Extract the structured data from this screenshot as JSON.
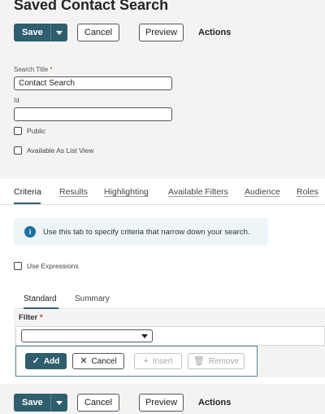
{
  "page": {
    "title": "Saved Contact Search"
  },
  "toolbar": {
    "save_label": "Save",
    "cancel_label": "Cancel",
    "preview_label": "Preview",
    "actions_label": "Actions"
  },
  "form": {
    "search_title": {
      "label": "Search Title",
      "required_mark": "*",
      "value": "Contact Search"
    },
    "id": {
      "label": "Id",
      "value": ""
    },
    "public": {
      "label": "Public",
      "checked": false
    },
    "list_view": {
      "label": "Available As List View",
      "checked": false
    }
  },
  "tabs": [
    {
      "label": "Criteria",
      "active": true
    },
    {
      "label": "Results",
      "active": false
    },
    {
      "label": "Highlighting",
      "active": false
    },
    {
      "label": "Available Filters",
      "active": false
    },
    {
      "label": "Audience",
      "active": false
    },
    {
      "label": "Roles",
      "active": false
    }
  ],
  "info": {
    "icon": "info-icon",
    "text": "Use this tab to specify criteria that narrow down your search."
  },
  "use_expressions": {
    "label": "Use Expressions",
    "checked": false
  },
  "subtabs": [
    {
      "label": "Standard",
      "active": true
    },
    {
      "label": "Summary",
      "active": false
    }
  ],
  "filter": {
    "label": "Filter",
    "required_mark": "*",
    "selected": "",
    "buttons": {
      "add": "Add",
      "cancel": "Cancel",
      "insert": "Insert",
      "remove": "Remove"
    }
  },
  "colors": {
    "primary": "#2f5e6e",
    "info_icon": "#1b6f9e",
    "required": "#c0392b",
    "panel_bg": "#f4f3f1"
  }
}
